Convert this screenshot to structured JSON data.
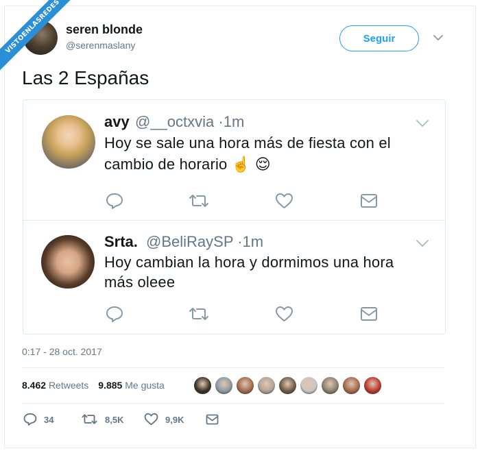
{
  "watermark": {
    "text": "VISTOENLASREDES"
  },
  "author": {
    "name": "seren blonde",
    "handle": "@serenmaslany",
    "follow_label": "Seguir"
  },
  "tweet": {
    "text": "Las 2 Españas"
  },
  "quotes": [
    {
      "name": "avy",
      "handle": "@__octxvia",
      "sep": "·",
      "time": "1m",
      "line1": "Hoy se sale una hora más de fiesta con el",
      "line2": "cambio de horario ☝️ 😌"
    },
    {
      "name": "Srta.",
      "handle": "@BeliRaySP",
      "sep": "·",
      "time": "1m",
      "line1": "Hoy cambian la hora y dormimos una hora",
      "line2": "más oleee"
    }
  ],
  "datetime": "0:17 - 28 oct. 2017",
  "stats": {
    "retweets_count": "8.462",
    "retweets_label": "Retweets",
    "likes_count": "9.885",
    "likes_label": "Me gusta"
  },
  "likers": [
    {
      "color": "#3b3326"
    },
    {
      "color": "#8d9aa3"
    },
    {
      "color": "#a06a4d"
    },
    {
      "color": "#b0a49a"
    },
    {
      "color": "#6e5a48"
    },
    {
      "color": "#c9c7c3"
    },
    {
      "color": "#8c8170"
    },
    {
      "color": "#a5684d"
    },
    {
      "color": "#b8372e"
    }
  ],
  "actions": {
    "replies": "34",
    "retweets": "8,5K",
    "likes": "9,9K"
  },
  "icons": [
    "reply-icon",
    "retweet-icon",
    "like-icon",
    "message-icon",
    "chevron-down-icon"
  ]
}
